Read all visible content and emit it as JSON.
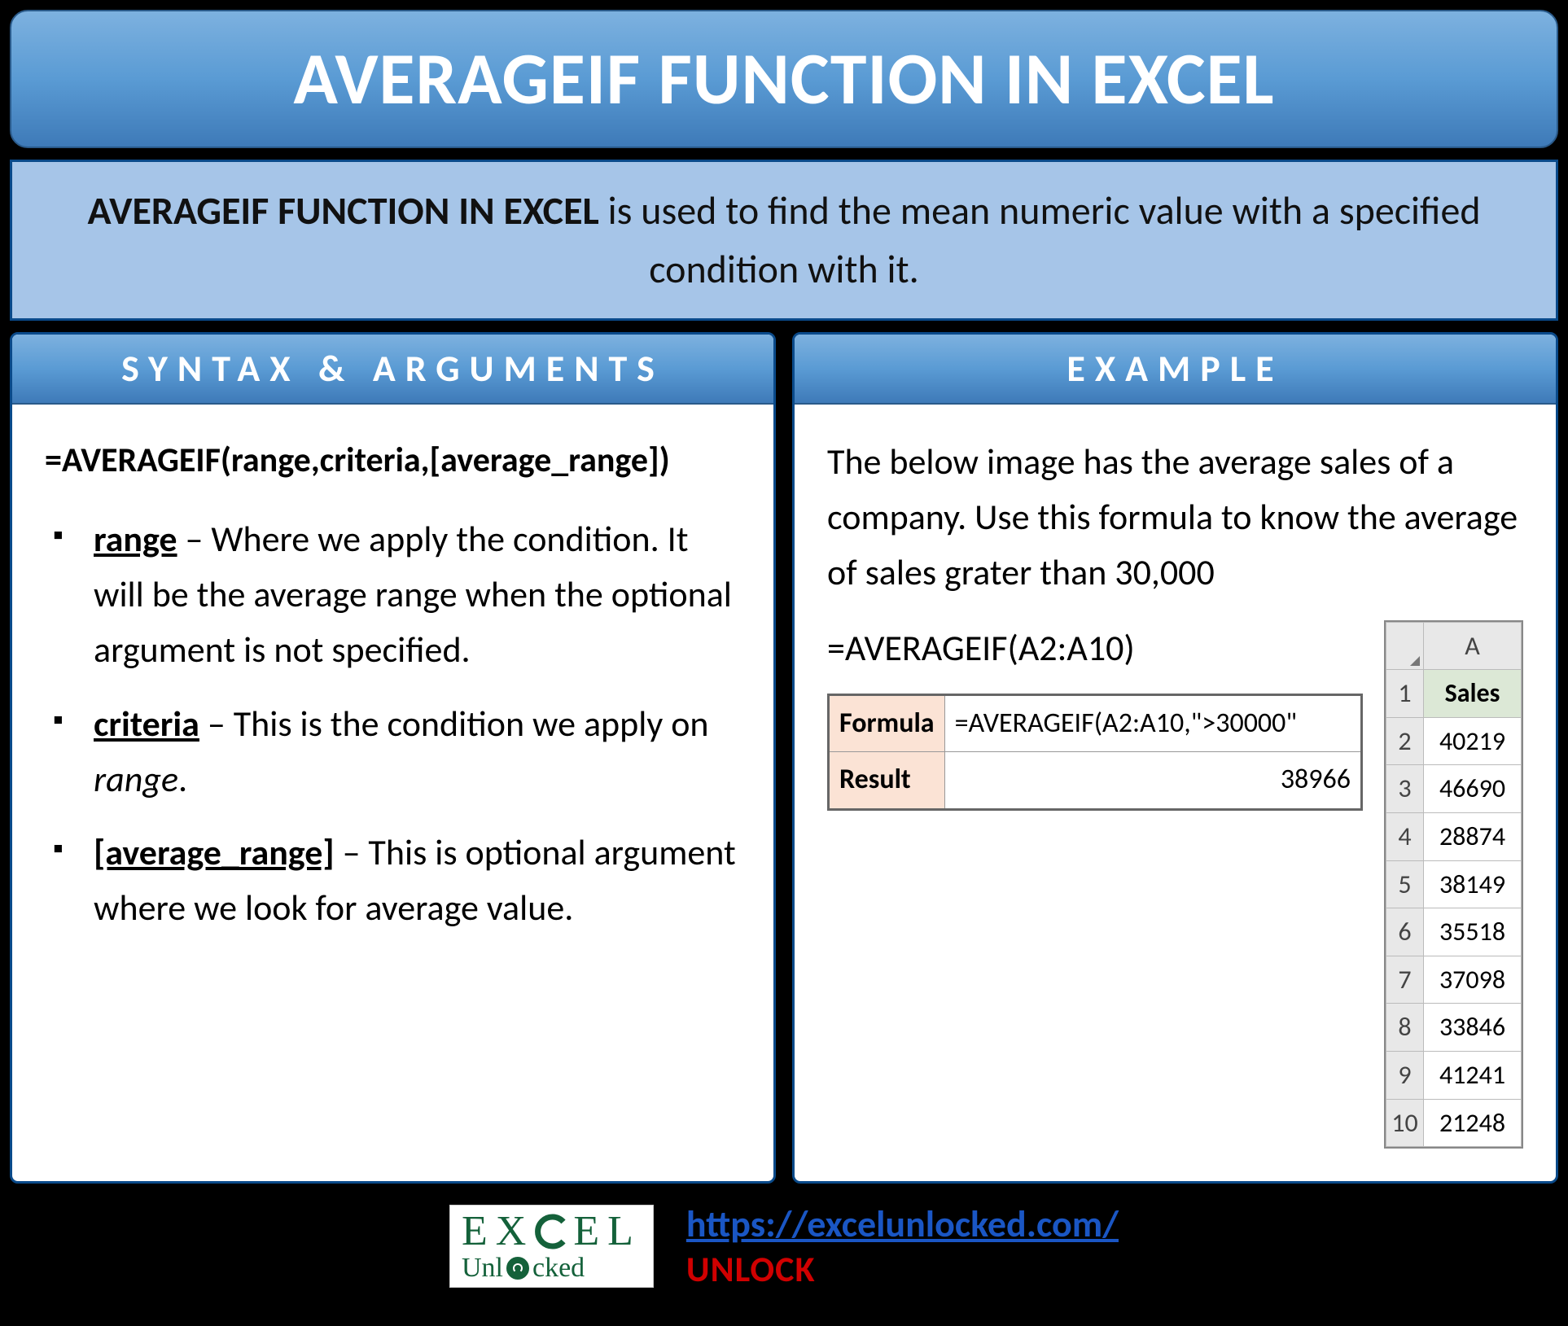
{
  "title": "AVERAGEIF FUNCTION IN EXCEL",
  "subtitle": {
    "bold": "AVERAGEIF FUNCTION IN EXCEL",
    "rest": " is used to find the mean numeric value with a specified condition with it."
  },
  "syntax": {
    "header": "SYNTAX & ARGUMENTS",
    "formula": "=AVERAGEIF(range,criteria,[average_range])",
    "args": [
      {
        "name": "range",
        "desc_before": " – Where we apply the condition. It will be the average range when the optional argument is not specified.",
        "italic_word": ""
      },
      {
        "name": "criteria",
        "desc_before": " – This is the condition we apply on ",
        "italic_word": "range",
        "desc_after": "."
      },
      {
        "name": "[average_range]",
        "desc_before": " – This is optional argument where we look for average value.",
        "italic_word": ""
      }
    ]
  },
  "example": {
    "header": "EXAMPLE",
    "text": "The below image has the average sales of a company. Use this formula to know the average of sales grater than 30,000",
    "short_formula": "=AVERAGEIF(A2:A10)",
    "formula_table": {
      "formula_label": "Formula",
      "formula_value": "=AVERAGEIF(A2:A10,\">30000\"",
      "result_label": "Result",
      "result_value": "38966"
    },
    "grid": {
      "col": "A",
      "header_cell": "Sales",
      "rows": [
        {
          "n": "1",
          "v": "Sales",
          "is_header": true
        },
        {
          "n": "2",
          "v": "40219"
        },
        {
          "n": "3",
          "v": "46690"
        },
        {
          "n": "4",
          "v": "28874"
        },
        {
          "n": "5",
          "v": "38149"
        },
        {
          "n": "6",
          "v": "35518"
        },
        {
          "n": "7",
          "v": "37098"
        },
        {
          "n": "8",
          "v": "33846"
        },
        {
          "n": "9",
          "v": "41241"
        },
        {
          "n": "10",
          "v": "21248"
        }
      ]
    }
  },
  "footer": {
    "logo_row1": "EX   EL",
    "logo_row2a": "Unl",
    "logo_row2b": "cked",
    "url": "https://excelunlocked.com/",
    "unlock": "UNLOCK"
  }
}
